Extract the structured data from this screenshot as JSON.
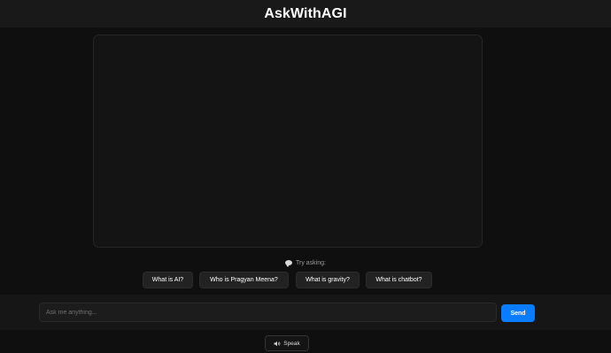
{
  "app": {
    "title": "AskWithAGI"
  },
  "suggestions": {
    "heading": "Try asking:",
    "icon": "speech-bubble-icon",
    "items": [
      {
        "label": "What is AI?"
      },
      {
        "label": "Who is Pragyan Meena?"
      },
      {
        "label": "What is gravity?"
      },
      {
        "label": "What is chatbot?"
      }
    ]
  },
  "composer": {
    "placeholder": "Ask me anything...",
    "value": "",
    "send_label": "Send"
  },
  "voice": {
    "label": "Speak",
    "icon": "speaker-icon"
  },
  "colors": {
    "background": "#0f0f0f",
    "header": "#191919",
    "accent": "#0a7cff",
    "chip": "#222222"
  }
}
